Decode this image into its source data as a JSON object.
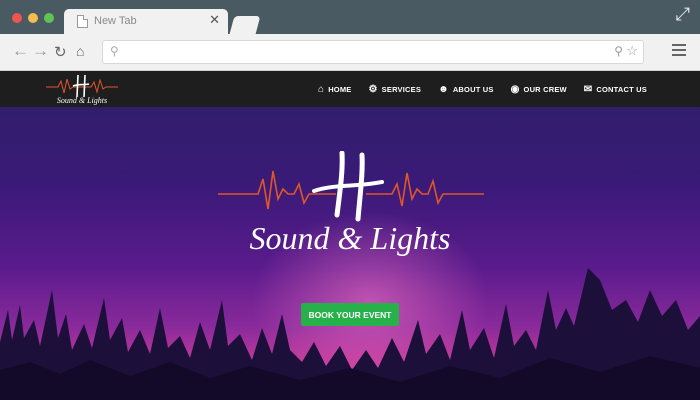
{
  "browser": {
    "tab_title": "New Tab",
    "tab_close": "✕"
  },
  "site": {
    "logo_text": "Sound & Lights",
    "nav": [
      {
        "label": "HOME",
        "icon": "home-icon"
      },
      {
        "label": "SERVICES",
        "icon": "gear-icon"
      },
      {
        "label": "ABOUT US",
        "icon": "user-icon"
      },
      {
        "label": "OUR CREW",
        "icon": "android-icon"
      },
      {
        "label": "CONTACT US",
        "icon": "envelope-icon"
      }
    ],
    "hero_logo_text": "Sound & Lights",
    "cta_label": "BOOK YOUR EVENT"
  },
  "colors": {
    "accent_green": "#27b14a",
    "waveform_orange": "#e0562b",
    "nav_bg": "#1e1e1e"
  }
}
